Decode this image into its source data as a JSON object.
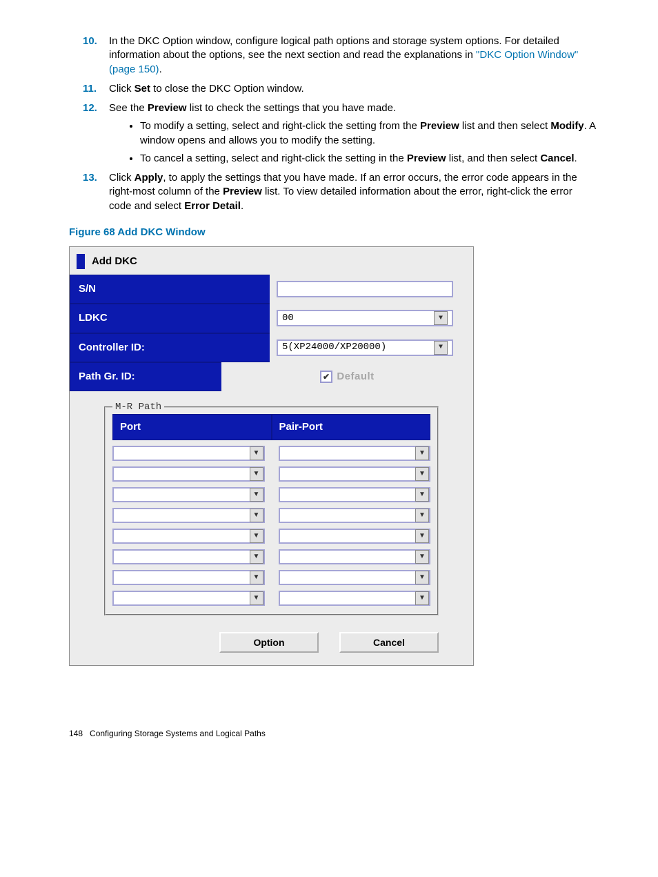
{
  "steps": {
    "s10": {
      "num": "10.",
      "text_a": "In the DKC Option window, configure logical path options and storage system options. For detailed information about the options, see the next section and read the explanations in ",
      "link": "\"DKC Option Window\" (page 150)",
      "text_b": "."
    },
    "s11": {
      "num": "11.",
      "a": "Click ",
      "b": "Set",
      "c": " to close the DKC Option window."
    },
    "s12": {
      "num": "12.",
      "a": "See the ",
      "b": "Preview",
      "c": " list to check the settings that you have made.",
      "bullets": [
        {
          "a": "To modify a setting, select and right-click the setting from the ",
          "b": "Preview",
          "c": " list and then select ",
          "d": "Modify",
          "e": ". A window opens and allows you to modify the setting."
        },
        {
          "a": "To cancel a setting, select and right-click the setting in the ",
          "b": "Preview",
          "c": " list, and then select ",
          "d": "Cancel",
          "e": "."
        }
      ]
    },
    "s13": {
      "num": "13.",
      "a": "Click ",
      "b": "Apply",
      "c": ", to apply the settings that you have made. If an error occurs, the error code appears in the right-most column of the ",
      "d": "Preview",
      "e": " list. To view detailed information about the error, right-click the error code and select ",
      "f": "Error Detail",
      "g": "."
    }
  },
  "figure_caption": "Figure 68 Add DKC Window",
  "dialog": {
    "title": "Add DKC",
    "sn_label": "S/N",
    "sn_value": "",
    "ldkc_label": "LDKC",
    "ldkc_value": "00",
    "controller_label": "Controller ID:",
    "controller_value": "5(XP24000/XP20000)",
    "pathgr_label": "Path Gr. ID:",
    "default_label": "Default",
    "mr_legend": "M-R Path",
    "port_header": "Port",
    "pairport_header": "Pair-Port",
    "option_btn": "Option",
    "cancel_btn": "Cancel"
  },
  "footer": {
    "page": "148",
    "section": "Configuring Storage Systems and Logical Paths"
  }
}
